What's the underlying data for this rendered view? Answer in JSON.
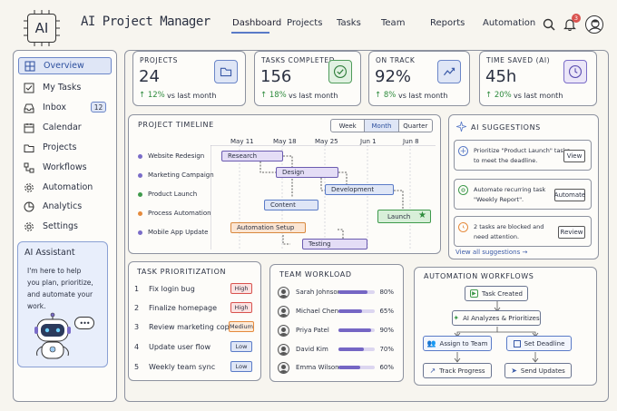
{
  "app": {
    "title": "AI Project Manager",
    "logo": "AI"
  },
  "topnav": {
    "items": [
      "Dashboard",
      "Projects",
      "Tasks",
      "Team",
      "Reports",
      "Automation"
    ],
    "notif_count": "3"
  },
  "sidebar": {
    "items": [
      {
        "label": "Overview",
        "icon": "grid-icon"
      },
      {
        "label": "My Tasks",
        "icon": "checkbox-icon"
      },
      {
        "label": "Inbox",
        "icon": "inbox-icon",
        "badge": "12"
      },
      {
        "label": "Calendar",
        "icon": "calendar-icon"
      },
      {
        "label": "Projects",
        "icon": "folder-icon"
      },
      {
        "label": "Workflows",
        "icon": "workflow-icon"
      },
      {
        "label": "Automation",
        "icon": "gear-icon"
      },
      {
        "label": "Analytics",
        "icon": "analytics-icon"
      },
      {
        "label": "Settings",
        "icon": "settings-icon"
      }
    ]
  },
  "assistant": {
    "title": "AI Assistant",
    "text": [
      "I'm here to help",
      "you plan, prioritize,",
      "and automate your",
      "work."
    ],
    "bubble": "•••"
  },
  "stats": [
    {
      "label": "PROJECTS",
      "value": "24",
      "change": "↑ 12%",
      "suffix": "vs last month"
    },
    {
      "label": "TASKS COMPLETED",
      "value": "156",
      "change": "↑ 18%",
      "suffix": "vs last month"
    },
    {
      "label": "ON TRACK",
      "value": "92%",
      "change": "↑ 8%",
      "suffix": "vs last month"
    },
    {
      "label": "TIME SAVED (AI)",
      "value": "45h",
      "change": "↑ 20%",
      "suffix": "vs last month"
    }
  ],
  "timeline": {
    "title": "PROJECT TIMELINE",
    "views": [
      "Week",
      "Month",
      "Quarter"
    ],
    "dates": [
      "May 11",
      "May 18",
      "May 25",
      "Jun 1",
      "Jun 8"
    ],
    "projects": [
      {
        "name": "Website Redesign",
        "color": "#7a6cc8"
      },
      {
        "name": "Marketing Campaign",
        "color": "#7a6cc8"
      },
      {
        "name": "Product Launch",
        "color": "#3f9a4c"
      },
      {
        "name": "Process Automation",
        "color": "#e58a3c"
      },
      {
        "name": "Mobile App Update",
        "color": "#7a6cc8"
      }
    ],
    "bars": [
      "Research",
      "Design",
      "Development",
      "Content",
      "Launch",
      "Automation Setup",
      "Testing"
    ]
  },
  "suggestions": {
    "title": "AI SUGGESTIONS",
    "items": [
      {
        "text": [
          "Prioritize \"Product Launch\" tasks",
          "to meet the deadline."
        ],
        "action": "View"
      },
      {
        "text": [
          "Automate recurring task",
          "\"Weekly Report\"."
        ],
        "action": "Automate"
      },
      {
        "text": [
          "2 tasks are blocked and",
          "need attention."
        ],
        "action": "Review"
      }
    ],
    "link": "View all suggestions →"
  },
  "prioritization": {
    "title": "TASK PRIORITIZATION",
    "tasks": [
      {
        "num": "1",
        "name": "Fix login bug",
        "priority": "High"
      },
      {
        "num": "2",
        "name": "Finalize homepage",
        "priority": "High"
      },
      {
        "num": "3",
        "name": "Review marketing copy",
        "priority": "Medium"
      },
      {
        "num": "4",
        "name": "Update user flow",
        "priority": "Low"
      },
      {
        "num": "5",
        "name": "Weekly team sync",
        "priority": "Low"
      }
    ]
  },
  "workload": {
    "title": "TEAM WORKLOAD",
    "members": [
      {
        "name": "Sarah Johnson",
        "pct": "80%",
        "value": 0.8
      },
      {
        "name": "Michael Chen",
        "pct": "65%",
        "value": 0.65
      },
      {
        "name": "Priya Patel",
        "pct": "90%",
        "value": 0.9
      },
      {
        "name": "David Kim",
        "pct": "70%",
        "value": 0.7
      },
      {
        "name": "Emma Wilson",
        "pct": "60%",
        "value": 0.6
      }
    ]
  },
  "workflows": {
    "title": "AUTOMATION WORKFLOWS",
    "nodes": [
      "Task Created",
      "AI Analyzes & Prioritizes",
      "Assign to Team",
      "Set Deadline",
      "Track Progress",
      "Send Updates"
    ]
  },
  "colors": {
    "accent": "#5a7bc7",
    "purple": "#7a6cc8",
    "green": "#3f9a4c",
    "red": "#d9534f",
    "bar_fill": "#e4ddf6"
  }
}
